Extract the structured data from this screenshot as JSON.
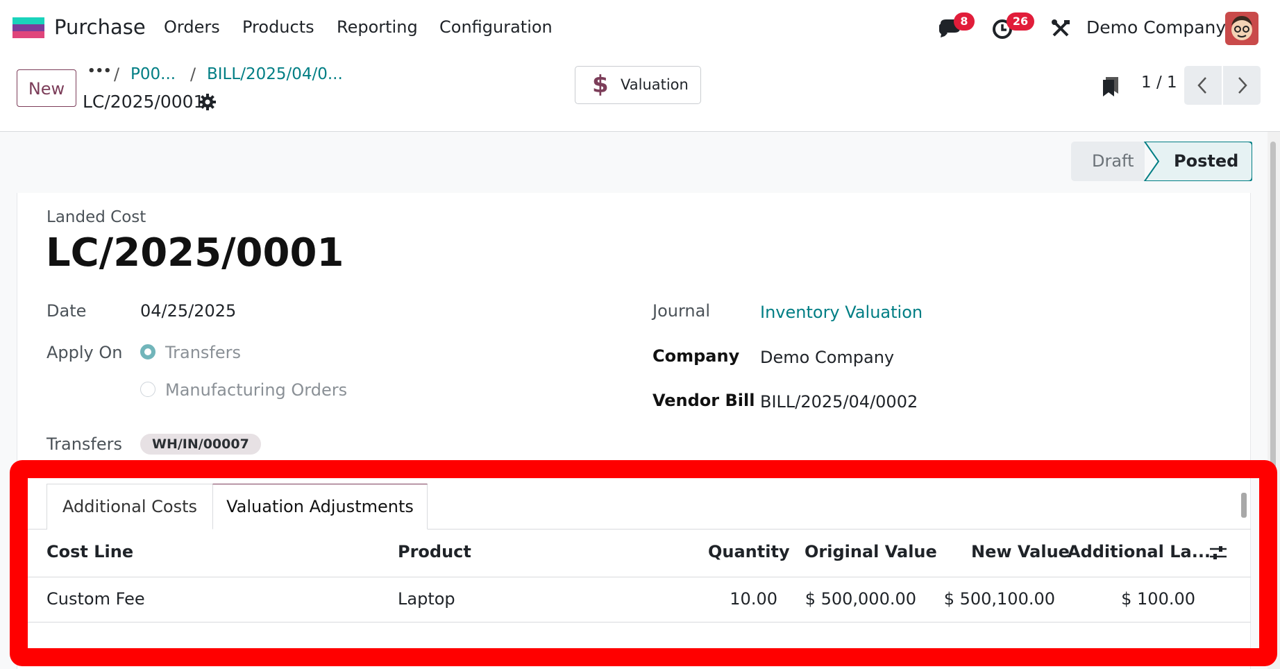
{
  "navbar": {
    "app_name": "Purchase",
    "menu": [
      "Orders",
      "Products",
      "Reporting",
      "Configuration"
    ],
    "messages_badge": "8",
    "activities_badge": "26",
    "company": "Demo Company",
    "brand_color": "#7c3d59",
    "badge_color": "#e11d3a"
  },
  "control_panel": {
    "new_label": "New",
    "breadcrumb_ellipsis": "•••",
    "breadcrumb_sep": "/",
    "breadcrumb_1": "P00...",
    "breadcrumb_2": "BILL/2025/04/0...",
    "record_title": "LC/2025/0001",
    "valuation_label": "Valuation",
    "pager_value": "1 / 1"
  },
  "status": {
    "steps": [
      "Draft",
      "Posted"
    ],
    "active": "Posted",
    "active_color": "#017e84"
  },
  "form": {
    "doc_type": "Landed Cost",
    "name": "LC/2025/0001",
    "date_label": "Date",
    "date_value": "04/25/2025",
    "apply_on_label": "Apply On",
    "apply_on_options": [
      "Transfers",
      "Manufacturing Orders"
    ],
    "apply_on_selected": "Transfers",
    "transfers_label": "Transfers",
    "transfers_tag": "WH/IN/00007",
    "journal_label": "Journal",
    "journal_value": "Inventory Valuation",
    "company_label": "Company",
    "company_value": "Demo Company",
    "vendor_bill_label": "Vendor Bill",
    "vendor_bill_value": "BILL/2025/04/0002"
  },
  "tabs": {
    "items": [
      "Additional Costs",
      "Valuation Adjustments"
    ],
    "active": "Valuation Adjustments"
  },
  "table": {
    "columns": [
      "Cost Line",
      "Product",
      "Quantity",
      "Original Value",
      "New Value",
      "Additional La..."
    ],
    "rows": [
      [
        "Custom Fee",
        "Laptop",
        "10.00",
        "$ 500,000.00",
        "$ 500,100.00",
        "$ 100.00"
      ]
    ]
  },
  "highlight_color": "#ff0000"
}
